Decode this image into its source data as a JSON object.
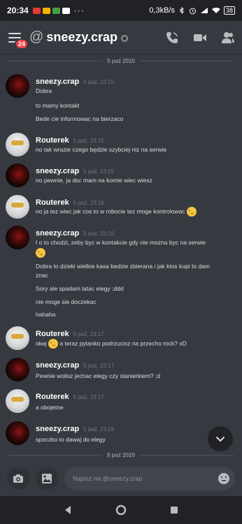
{
  "status_bar": {
    "time": "20:34",
    "dots": "···",
    "network_speed": "0,3kB/s",
    "battery": "38"
  },
  "header": {
    "notification_count": "24",
    "at_symbol": "@",
    "channel_name": "sneezy.crap"
  },
  "dividers": [
    "5 paź 2020",
    "8 paź 2020"
  ],
  "messages": [
    {
      "author": "sneezy.crap",
      "time": "5 paź, 23:15",
      "avatar": "dark",
      "lines": [
        "Dobra",
        "to mamy kontakt",
        "Bede cie informowac na bierzaco"
      ]
    },
    {
      "author": "Routerek",
      "time": "5 paź, 23:15",
      "avatar": "light",
      "lines": [
        "no tak wrazie czego będzie szybciej niz na serwie"
      ]
    },
    {
      "author": "sneezy.crap",
      "time": "5 paź, 23:15",
      "avatar": "dark",
      "lines": [
        "no pewnie, ja dsc mam na komie wiec wiesz"
      ]
    },
    {
      "author": "Routerek",
      "time": "5 paź, 23:16",
      "avatar": "light",
      "lines": [
        "no ja tez wiec jak cos to w robocie tez moge kontrolowac"
      ]
    },
    {
      "author": "sneezy.crap",
      "time": "5 paź, 23:16",
      "avatar": "dark",
      "lines": [
        "I o to chodzi, zeby byc w kontakcie gdy nie mozna byc na serwie",
        "Dobra to dzieki wielkie kasa bedzie zbierana i jak ktos kupi to dam",
        "znac",
        "Sory ale spadam latac elegy ;ddd",
        "nie moge sie doczekac",
        "hahaha"
      ]
    },
    {
      "author": "Routerek",
      "time": "5 paź, 23:17",
      "avatar": "light",
      "lines": [
        "okej",
        "a teraz pytanko podrzucisz na przecho rock? xD"
      ]
    },
    {
      "author": "sneezy.crap",
      "time": "5 paź, 23:17",
      "avatar": "dark",
      "lines": [
        "Pewnie wolisz jechac elegy czy stanierkiem? ;d"
      ]
    },
    {
      "author": "Routerek",
      "time": "5 paź, 23:17",
      "avatar": "light",
      "lines": [
        "a obojetne"
      ]
    },
    {
      "author": "sneezy.crap",
      "time": "5 paź, 23:18",
      "avatar": "dark",
      "lines": [
        "spoczko to dawaj do elegy"
      ]
    }
  ],
  "composer": {
    "placeholder": "Napisz na @sneezy.crap"
  },
  "icons": {
    "menu": "hamburger-icon",
    "call": "phone-icon",
    "video": "video-camera-icon",
    "members": "people-icon",
    "camera": "camera-icon",
    "gallery": "image-icon",
    "emoji": "emoji-icon",
    "scroll": "chevron-down-icon"
  },
  "colors": {
    "background": "#36393f",
    "badge": "#ed4245",
    "author": "#ffffff",
    "text": "#dcddde",
    "timestamp": "#72767d",
    "emoji": "#f5c441"
  }
}
